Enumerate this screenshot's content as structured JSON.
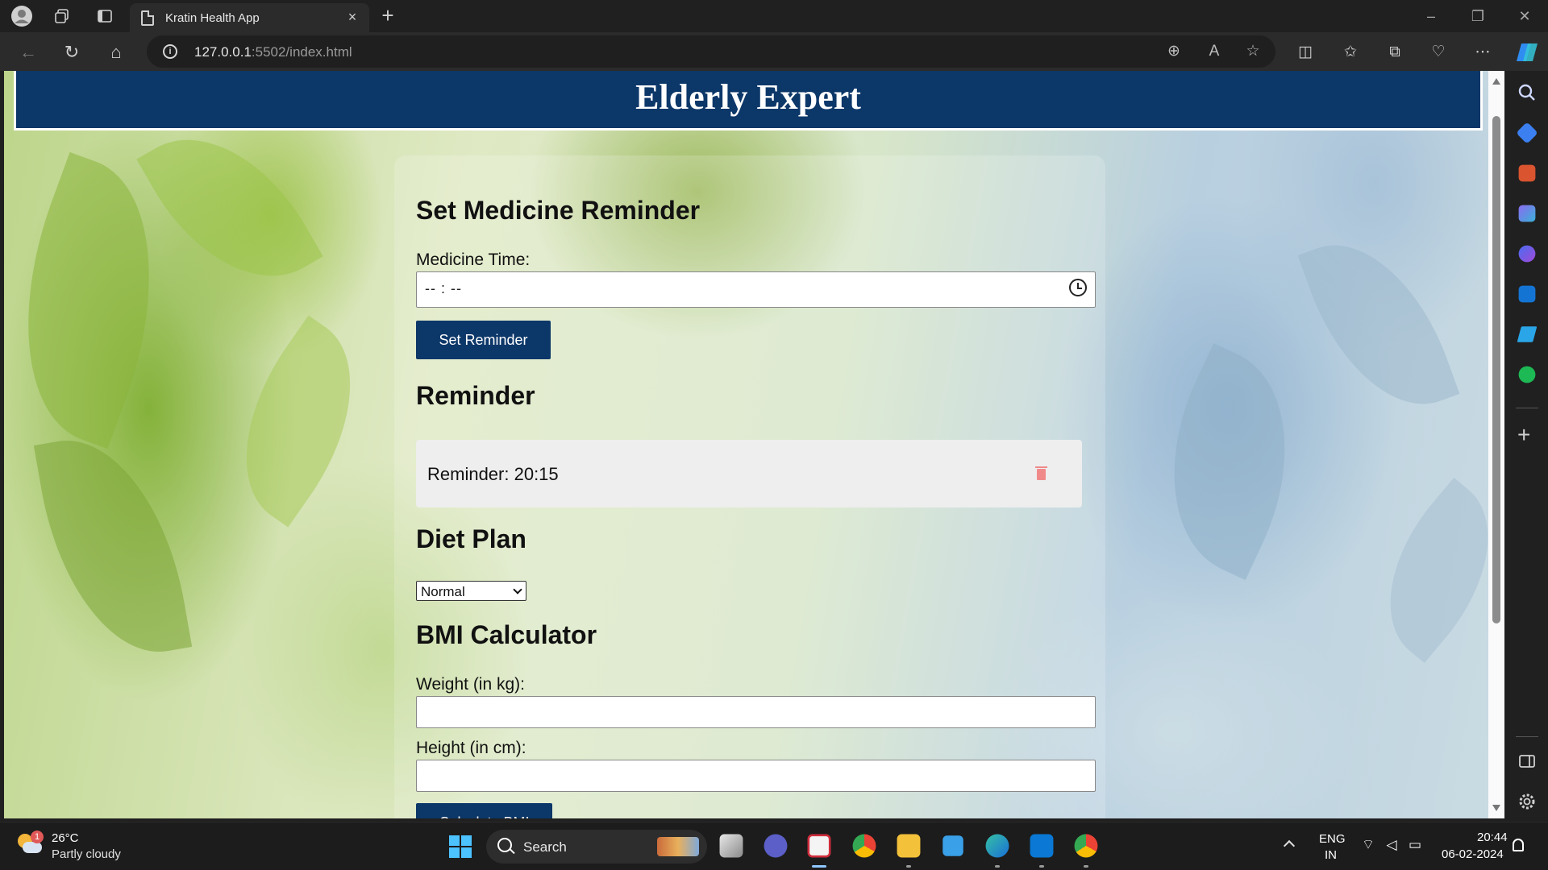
{
  "browser": {
    "tab_title": "Kratin Health App",
    "tab_close": "×",
    "new_tab": "+",
    "url_host": "127.0.0.1",
    "url_path": ":5502/index.html",
    "window_controls": {
      "minimize": "–",
      "restore": "❐",
      "close": "✕"
    }
  },
  "page": {
    "site_title": "Elderly Expert",
    "reminder_section": {
      "heading": "Set Medicine Reminder",
      "time_label": "Medicine Time:",
      "time_value": "-- : --",
      "button_label": "Set Reminder"
    },
    "reminder_list": {
      "heading": "Reminder",
      "items": [
        {
          "text": "Reminder: 20:15"
        }
      ]
    },
    "diet_plan": {
      "heading": "Diet Plan",
      "selected": "Normal"
    },
    "bmi": {
      "heading": "BMI Calculator",
      "weight_label": "Weight (in kg):",
      "height_label": "Height (in cm):",
      "button_label": "Calculate BMI"
    },
    "colors": {
      "header_bg": "#0c3769",
      "button_bg": "#0c3769",
      "reminder_card_bg": "#eeeeee"
    }
  },
  "taskbar": {
    "weather_temp": "26°C",
    "weather_desc": "Partly cloudy",
    "weather_badge": "1",
    "search_label": "Search",
    "lang_line1": "ENG",
    "lang_line2": "IN",
    "time": "20:44",
    "date": "06-02-2024"
  }
}
